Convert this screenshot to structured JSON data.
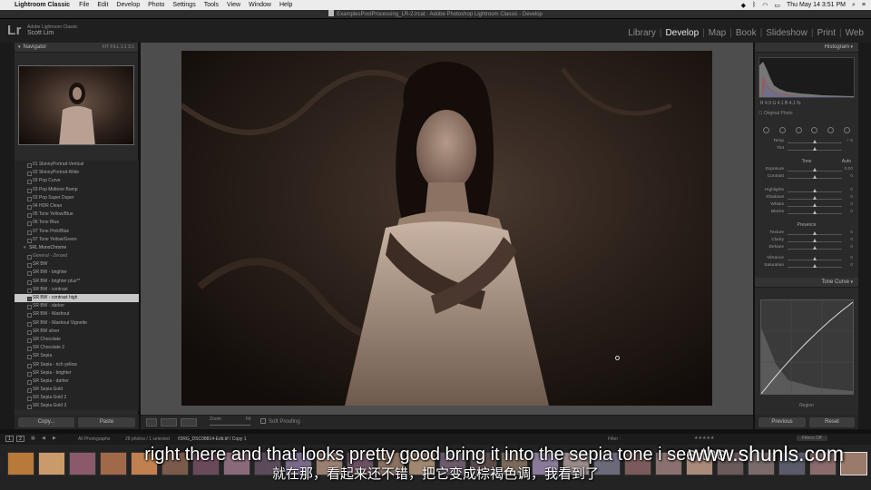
{
  "menubar": {
    "app": "Lightroom Classic",
    "items": [
      "File",
      "Edit",
      "Develop",
      "Photo",
      "Settings",
      "Tools",
      "View",
      "Window",
      "Help"
    ],
    "clock": "Thu May 14  3:51 PM"
  },
  "window_title": "ExamplesPostProcessing_LR-2.lrcat - Adobe Photoshop Lightroom Classic - Develop",
  "identity": {
    "logo": "Lr",
    "line1": "Adobe Lightroom Classic",
    "line2": "Scott Lim"
  },
  "modules": [
    "Library",
    "Develop",
    "Map",
    "Book",
    "Slideshow",
    "Print",
    "Web"
  ],
  "active_module": "Develop",
  "navigator": {
    "title": "Navigator",
    "options": "FIT  FILL  1:1  3:1"
  },
  "presets": [
    {
      "label": "01 SkinnyPortrait-Vertical",
      "type": "item"
    },
    {
      "label": "02 SkinnyPortrait-Wide",
      "type": "item"
    },
    {
      "label": "03 Pop Curve",
      "type": "item"
    },
    {
      "label": "03 Pop Midtone Bump",
      "type": "item"
    },
    {
      "label": "03 Pop Super Duper",
      "type": "item"
    },
    {
      "label": "04 HDR Clean",
      "type": "item"
    },
    {
      "label": "05 Tone Yellow/Blue",
      "type": "item"
    },
    {
      "label": "06 Tone Blue",
      "type": "item"
    },
    {
      "label": "07 Tone Pink/Blue",
      "type": "item"
    },
    {
      "label": "07 Tone Yellow/Green",
      "type": "item"
    },
    {
      "label": "SRL MonoChrome",
      "type": "folder"
    },
    {
      "label": "General - Zeroed",
      "type": "ital"
    },
    {
      "label": "SR BW",
      "type": "item"
    },
    {
      "label": "SR BW - brighter",
      "type": "item"
    },
    {
      "label": "SR BW - brighter plus**",
      "type": "item"
    },
    {
      "label": "SR BW - contrast",
      "type": "item"
    },
    {
      "label": "SR BW - contrast high",
      "type": "sel"
    },
    {
      "label": "SR BW - darker",
      "type": "item"
    },
    {
      "label": "SR BW - Washout",
      "type": "item"
    },
    {
      "label": "SR BW - Washout Vignette",
      "type": "item"
    },
    {
      "label": "SR BW silver",
      "type": "item"
    },
    {
      "label": "SR Chocolate",
      "type": "item"
    },
    {
      "label": "SR Chocolate 2",
      "type": "item"
    },
    {
      "label": "SR Sepia",
      "type": "item"
    },
    {
      "label": "SR Sepia - rich yellow",
      "type": "item"
    },
    {
      "label": "SR Sepia - brighter",
      "type": "item"
    },
    {
      "label": "SR Sepia - darker",
      "type": "item"
    },
    {
      "label": "SR Sepia Gold",
      "type": "item"
    },
    {
      "label": "SR Sepia Gold 2",
      "type": "item"
    },
    {
      "label": "SR Sepia Gold 3",
      "type": "item"
    }
  ],
  "left_buttons": {
    "copy": "Copy...",
    "paste": "Paste"
  },
  "toolbar": {
    "zoom": "Zoom",
    "fit": "Fit",
    "soft_proofing": "Soft Proofing"
  },
  "histogram": {
    "title": "Histogram",
    "values": "R  4.9  G  4.1  B  4.1 %",
    "original_photo": "Original Photo"
  },
  "basic": {
    "wb_sliders": [
      {
        "label": "Temp",
        "value": "+ 6"
      },
      {
        "label": "Tint",
        "value": ""
      }
    ],
    "tone_label": "Tone",
    "auto_label": "Auto",
    "tone_sliders": [
      {
        "label": "Exposure",
        "value": "0.00"
      },
      {
        "label": "Contrast",
        "value": "0"
      },
      {
        "label": "Highlights",
        "value": "0"
      },
      {
        "label": "Shadows",
        "value": "0"
      },
      {
        "label": "Whites",
        "value": "0"
      },
      {
        "label": "Blacks",
        "value": "0"
      }
    ],
    "presence_label": "Presence",
    "presence_sliders": [
      {
        "label": "Texture",
        "value": "0"
      },
      {
        "label": "Clarity",
        "value": "0"
      },
      {
        "label": "Dehaze",
        "value": "0"
      },
      {
        "label": "Vibrance",
        "value": "0"
      },
      {
        "label": "Saturation",
        "value": "0"
      }
    ]
  },
  "tone_curve": {
    "title": "Tone Curve",
    "region": "Region"
  },
  "right_buttons": {
    "previous": "Previous",
    "reset": "Reset"
  },
  "filmbar": {
    "source": "All Photographs",
    "info": "28 photos / 1 selected",
    "file": "/ORG_DSC08814-Edit.tif / Copy 1",
    "filter_label": "Filter :",
    "filters_off": "Filters Off"
  },
  "subtitles": {
    "english": "right there and that looks pretty good bring it into the sepia tone i see the",
    "chinese": "就在那，看起来还不错，把它变成棕褐色调，我看到了"
  },
  "watermark": "www.shunls.com"
}
